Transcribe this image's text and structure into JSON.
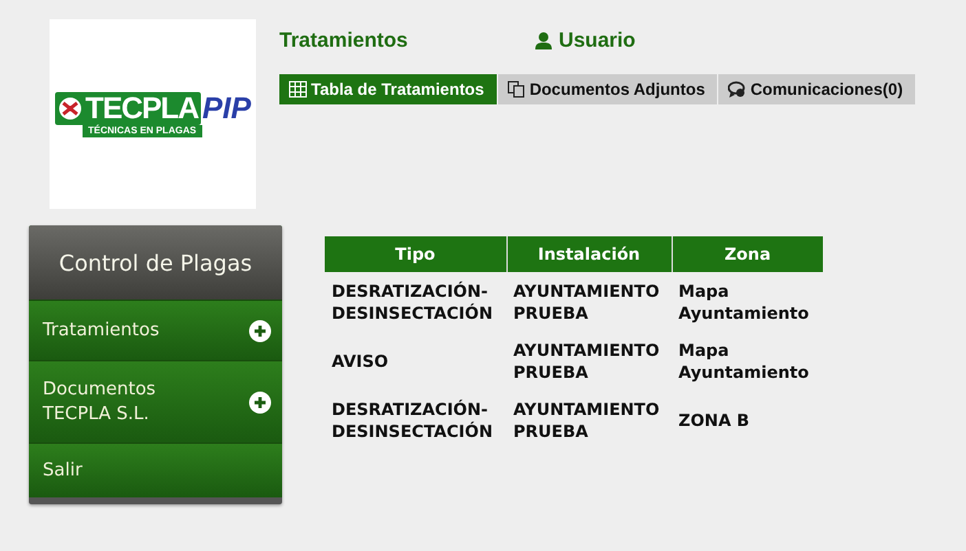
{
  "logo": {
    "brand": "TECPLA",
    "brand_suffix": "PIP",
    "tagline": "TÉCNICAS EN PLAGAS"
  },
  "header": {
    "title": "Tratamientos",
    "user": "Usuario"
  },
  "tabs": [
    {
      "label": "Tabla de Tratamientos",
      "kind": "table",
      "selected": true
    },
    {
      "label": "Documentos Adjuntos",
      "kind": "documents",
      "selected": false
    },
    {
      "label": "Comunicaciones(0)",
      "kind": "chat",
      "selected": false
    }
  ],
  "sidebar": {
    "title": "Control de Plagas",
    "items": [
      {
        "label": "Tratamientos",
        "expandable": true
      },
      {
        "label": "Documentos TECPLA S.L.",
        "expandable": true
      },
      {
        "label": "Salir",
        "expandable": false
      }
    ]
  },
  "table": {
    "columns": [
      "Tipo",
      "Instalación",
      "Zona"
    ],
    "rows": [
      [
        "DESRATIZACIÓN-DESINSECTACIÓN",
        "AYUNTAMIENTO PRUEBA",
        "Mapa Ayuntamiento"
      ],
      [
        "AVISO",
        "AYUNTAMIENTO PRUEBA",
        "Mapa Ayuntamiento"
      ],
      [
        "DESRATIZACIÓN-DESINSECTACIÓN",
        "AYUNTAMIENTO PRUEBA",
        "ZONA B"
      ]
    ]
  }
}
